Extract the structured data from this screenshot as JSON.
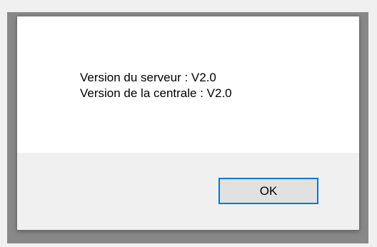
{
  "dialog": {
    "message_lines": [
      "Version du serveur : V2.0",
      "Version de la centrale : V2.0"
    ],
    "ok_label": "OK"
  },
  "colors": {
    "frame": "#888888",
    "dialog_background": "#ffffff",
    "footer_background": "#f0f0f0",
    "button_background": "#e1e1e1",
    "button_focus_border": "#0078d7"
  }
}
